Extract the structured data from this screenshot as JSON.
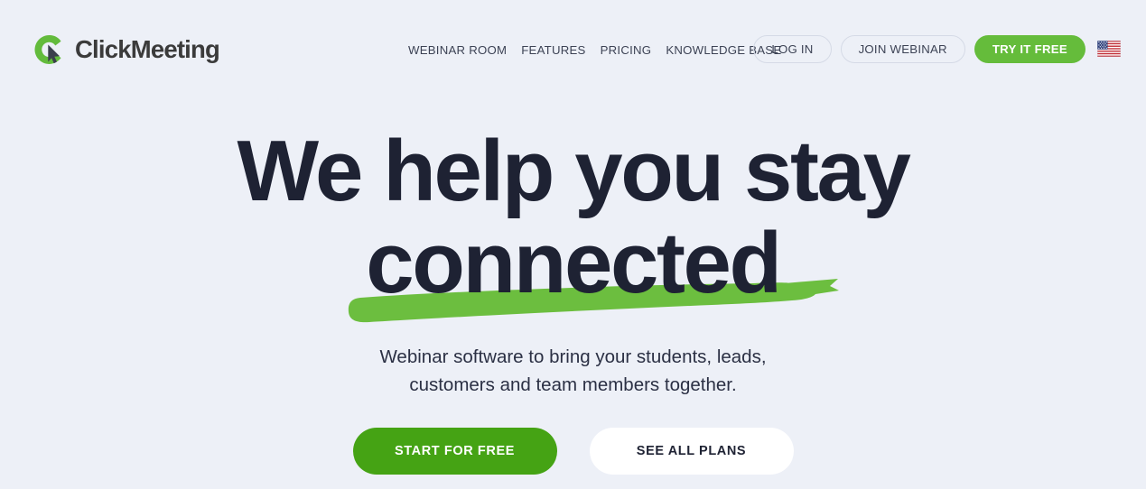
{
  "brand": {
    "name": "ClickMeeting",
    "logo_icon": "clickmeeting-cursor-logo",
    "mark_color": "#63bb3c",
    "text_color": "#3b3b3b"
  },
  "nav": {
    "items": [
      {
        "label": "WEBINAR ROOM"
      },
      {
        "label": "FEATURES"
      },
      {
        "label": "PRICING"
      },
      {
        "label": "KNOWLEDGE BASE"
      }
    ]
  },
  "header_actions": {
    "login_label": "LOG IN",
    "join_webinar_label": "JOIN WEBINAR",
    "try_free_label": "TRY IT FREE",
    "try_free_color": "#65bc3b",
    "language_flag": "us-flag-icon",
    "language_code": "US"
  },
  "hero": {
    "headline_line1": "We help you stay",
    "headline_line2": "connected",
    "headline_color": "#1e2233",
    "underline_accent_color": "#6cbe3f",
    "subtitle_line1": "Webinar software to bring your students, leads,",
    "subtitle_line2": "customers and team members together.",
    "cta_primary_label": "START FOR FREE",
    "cta_primary_color": "#45a314",
    "cta_secondary_label": "SEE ALL PLANS",
    "cta_secondary_color": "#ffffff"
  },
  "page": {
    "background_color": "#edf0f7"
  }
}
